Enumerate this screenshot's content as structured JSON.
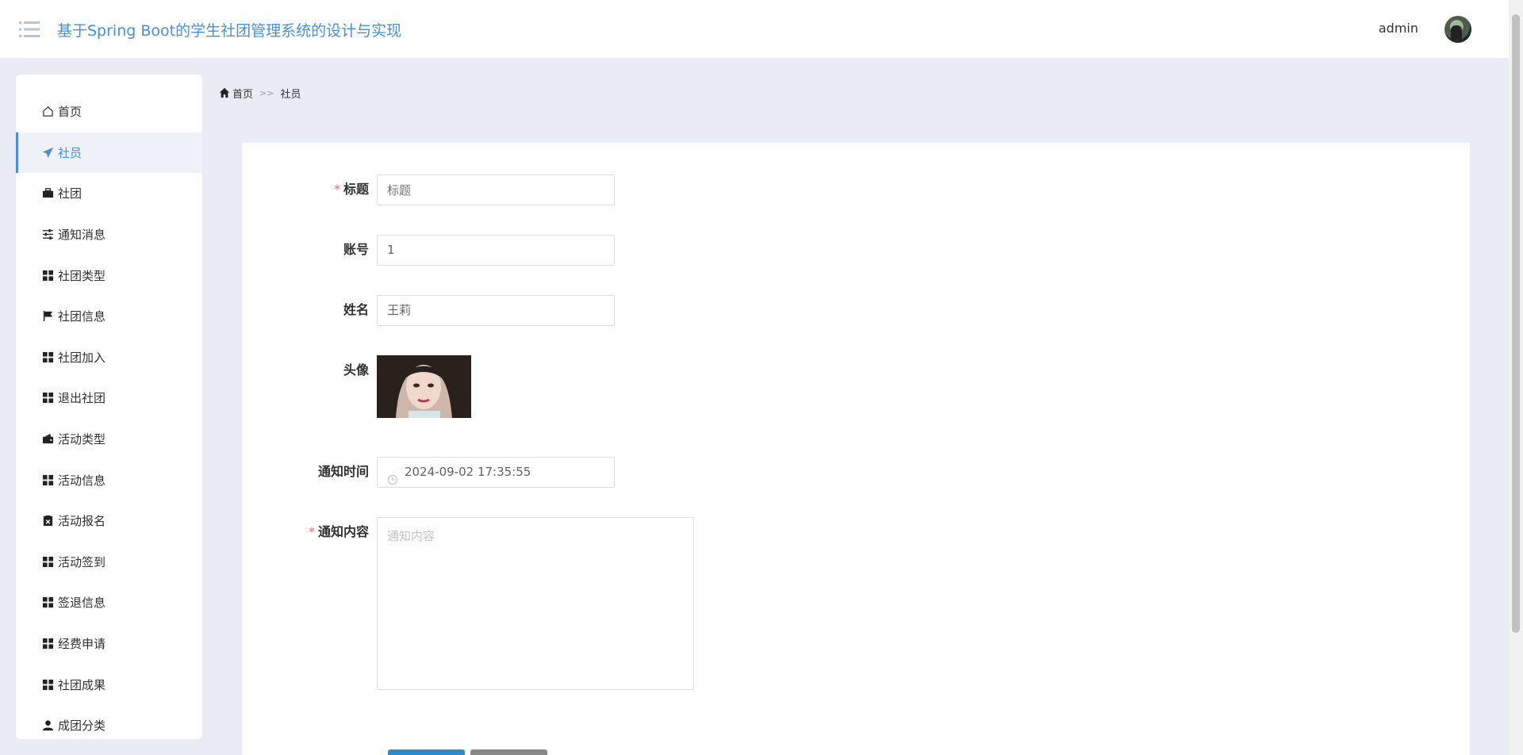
{
  "header": {
    "title": "基于Spring Boot的学生社团管理系统的设计与实现",
    "username": "admin"
  },
  "sidebar": {
    "items": [
      {
        "label": "首页",
        "icon": "home-icon"
      },
      {
        "label": "社员",
        "icon": "paper-plane-icon",
        "active": true
      },
      {
        "label": "社团",
        "icon": "briefcase-icon"
      },
      {
        "label": "通知消息",
        "icon": "sliders-icon"
      },
      {
        "label": "社团类型",
        "icon": "grid-icon"
      },
      {
        "label": "社团信息",
        "icon": "flag-icon"
      },
      {
        "label": "社团加入",
        "icon": "grid-icon"
      },
      {
        "label": "退出社团",
        "icon": "grid-icon"
      },
      {
        "label": "活动类型",
        "icon": "wallet-icon"
      },
      {
        "label": "活动信息",
        "icon": "grid-icon"
      },
      {
        "label": "活动报名",
        "icon": "clipboard-x-icon"
      },
      {
        "label": "活动签到",
        "icon": "grid-icon"
      },
      {
        "label": "签退信息",
        "icon": "grid-icon"
      },
      {
        "label": "经费申请",
        "icon": "grid-icon"
      },
      {
        "label": "社团成果",
        "icon": "grid-icon"
      },
      {
        "label": "成团分类",
        "icon": "user-icon"
      }
    ]
  },
  "breadcrumb": {
    "home": "首页",
    "separator": ">>",
    "current": "社员"
  },
  "form": {
    "title": {
      "label": "标题",
      "placeholder": "标题",
      "value": "",
      "required": true
    },
    "account": {
      "label": "账号",
      "value": "1"
    },
    "name": {
      "label": "姓名",
      "value": "王莉"
    },
    "avatar": {
      "label": "头像"
    },
    "notify_time": {
      "label": "通知时间",
      "value": "2024-09-02 17:35:55"
    },
    "content": {
      "label": "通知内容",
      "placeholder": "通知内容",
      "required": true
    }
  },
  "colors": {
    "accent": "#4a8fcf",
    "background": "#e9ecf4",
    "required": "#f56c6c",
    "primary_button": "#2f8ac7"
  }
}
